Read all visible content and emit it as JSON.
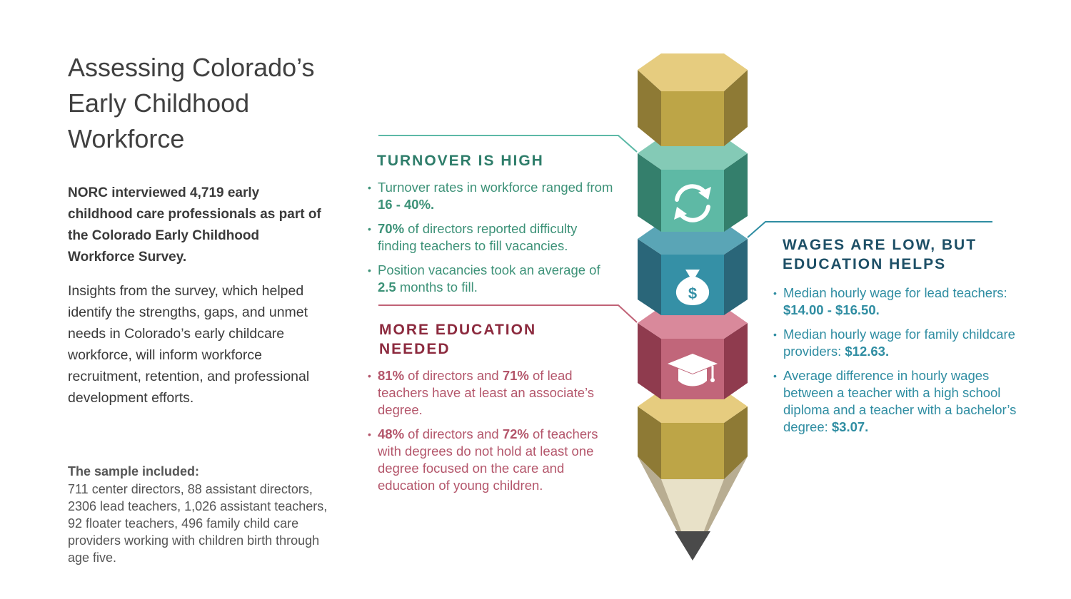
{
  "title": "Assessing Colorado’s Early Childhood Workforce",
  "intro_bold": "NORC interviewed 4,719 early childhood care professionals as part of the Colorado Early Childhood Workforce Survey.",
  "intro_body": "Insights from the survey, which helped identify the strengths, gaps, and unmet needs in Colorado’s early childcare workforce, will inform workforce recruitment, retention, and professional development efforts.",
  "sample": {
    "heading": "The sample included:",
    "body": "711 center directors, 88 assistant directors, 2306 lead teachers, 1,026 assistant teachers, 92 floater teachers, 496 family child care providers working with children birth through age five."
  },
  "turnover": {
    "heading": "TURNOVER IS HIGH",
    "items": [
      {
        "pre": "Turnover rates in workforce ranged from ",
        "b1": "16 - 40%.",
        "mid": "",
        "b2": "",
        "post": ""
      },
      {
        "pre": "",
        "b1": "70%",
        "mid": " of directors reported difficulty finding teachers to fill vacancies.",
        "b2": "",
        "post": ""
      },
      {
        "pre": "Position vacancies took an average of ",
        "b1": "2.5",
        "mid": " months to fill.",
        "b2": "",
        "post": ""
      }
    ]
  },
  "education": {
    "heading": "MORE EDUCATION NEEDED",
    "items": [
      {
        "pre": "",
        "b1": "81%",
        "mid": " of directors and ",
        "b2": "71%",
        "post": " of lead teachers have at least an associate’s degree."
      },
      {
        "pre": "",
        "b1": "48%",
        "mid": " of directors and ",
        "b2": "72%",
        "post": " of teachers with degrees do not hold at least one degree focused on the care and education of young children."
      }
    ]
  },
  "wages": {
    "heading": "WAGES ARE LOW, BUT EDUCATION HELPS",
    "items": [
      {
        "pre": "Median hourly wage for lead teachers: ",
        "b1": "$14.00 - $16.50.",
        "mid": "",
        "b2": "",
        "post": ""
      },
      {
        "pre": "Median hourly wage for family childcare providers: ",
        "b1": "$12.63.",
        "mid": "",
        "b2": "",
        "post": ""
      },
      {
        "pre": "Average difference in hourly wages between a teacher with a high school diploma and a teacher with a bachelor’s degree: ",
        "b1": "$3.07.",
        "mid": "",
        "b2": "",
        "post": ""
      }
    ]
  },
  "icons": [
    "refresh-icon",
    "money-bag-icon",
    "graduation-cap-icon"
  ],
  "icon_text": {
    "money": "$"
  },
  "colors": {
    "teal": "#3d9278",
    "red": "#b4566b",
    "blue": "#2f8da2",
    "gold": "#c1a84a"
  }
}
